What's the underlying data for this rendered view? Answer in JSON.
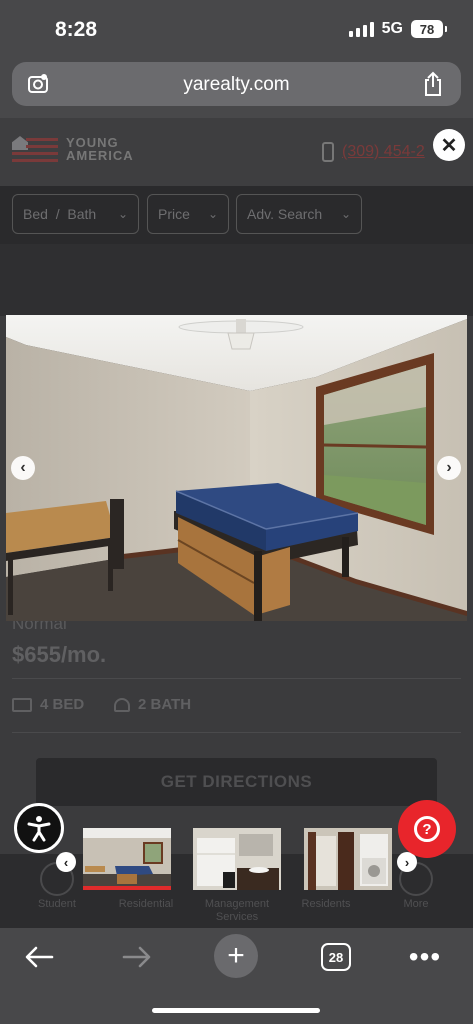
{
  "status_bar": {
    "time": "8:28",
    "network": "5G",
    "battery": "78"
  },
  "browser": {
    "url": "yarealty.com",
    "tab_count": "28"
  },
  "site": {
    "logo_line1": "YOUNG",
    "logo_line2": "AMERICA",
    "phone": "(309) 454-2"
  },
  "filters": [
    {
      "label": "Bed  /  Bath"
    },
    {
      "label": "Price"
    },
    {
      "label": "Adv. Search"
    }
  ],
  "listing": {
    "name": "Normal",
    "price": "$655/mo.",
    "beds": "4 BED",
    "baths": "2 BATH",
    "directions_label": "GET DIRECTIONS"
  },
  "bottom_nav": [
    {
      "label": "Student"
    },
    {
      "label": "Residential"
    },
    {
      "label": "Management Services"
    },
    {
      "label": "Residents"
    },
    {
      "label": "More"
    }
  ],
  "gallery": {
    "thumbnails": [
      {
        "name": "bedroom",
        "active": true
      },
      {
        "name": "bathroom",
        "active": false
      },
      {
        "name": "hallway-laundry",
        "active": false
      }
    ]
  },
  "colors": {
    "help_button": "#e8252b",
    "active_thumb_indicator": "#e02b2b"
  }
}
